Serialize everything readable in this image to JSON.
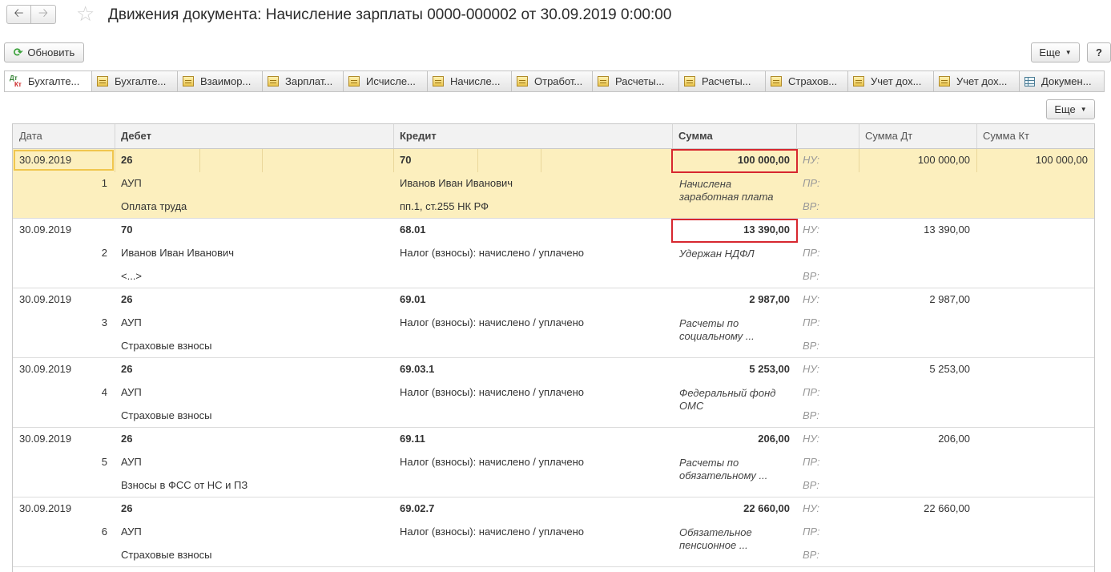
{
  "window": {
    "title": "Движения документа: Начисление зарплаты 0000-000002 от 30.09.2019 0:00:00",
    "back_icon": "arrow-left-icon",
    "forward_icon": "arrow-right-icon",
    "favorite_icon": "star-icon"
  },
  "toolbar": {
    "refresh_label": "Обновить",
    "more_label": "Еще",
    "help_label": "?"
  },
  "tabs": [
    {
      "label": "Бухгалте...",
      "icon": "dt-kt-icon",
      "active": true
    },
    {
      "label": "Бухгалте...",
      "icon": "register-icon"
    },
    {
      "label": "Взаимор...",
      "icon": "register-icon"
    },
    {
      "label": "Зарплат...",
      "icon": "register-icon"
    },
    {
      "label": "Исчисле...",
      "icon": "register-icon"
    },
    {
      "label": "Начисле...",
      "icon": "register-icon"
    },
    {
      "label": "Отработ...",
      "icon": "register-icon"
    },
    {
      "label": "Расчеты...",
      "icon": "register-icon"
    },
    {
      "label": "Расчеты...",
      "icon": "register-icon"
    },
    {
      "label": "Страхов...",
      "icon": "register-icon"
    },
    {
      "label": "Учет дох...",
      "icon": "register-icon"
    },
    {
      "label": "Учет дох...",
      "icon": "register-icon"
    },
    {
      "label": "Докумен...",
      "icon": "table-icon"
    }
  ],
  "panel": {
    "more_label": "Еще"
  },
  "columns": {
    "date": "Дата",
    "debit": "Дебет",
    "credit": "Кредит",
    "amount": "Сумма",
    "blank": "",
    "amount_dt": "Сумма Дт",
    "amount_kt": "Сумма Кт"
  },
  "labels": {
    "nu": "НУ:",
    "pr": "ПР:",
    "vr": "ВР:"
  },
  "rows": [
    {
      "date": "30.09.2019",
      "num": "1",
      "debit": "26",
      "debit_sub1": "АУП",
      "debit_sub2": "Оплата труда",
      "credit": "70",
      "credit_sub1": "Иванов Иван Иванович",
      "credit_sub2": "пп.1, ст.255 НК РФ",
      "amount": "100 000,00",
      "desc1": "Начислена",
      "desc2": "заработная плата",
      "nu_dt": "100 000,00",
      "nu_kt": "100 000,00",
      "selected": true
    },
    {
      "date": "30.09.2019",
      "num": "2",
      "debit": "70",
      "debit_sub1": "Иванов Иван Иванович",
      "debit_sub2": "<...>",
      "credit": "68.01",
      "credit_sub1": "Налог (взносы): начислено / уплачено",
      "credit_sub2": "",
      "amount": "13 390,00",
      "desc1": "Удержан НДФЛ",
      "desc2": "",
      "nu_dt": "13 390,00",
      "nu_kt": ""
    },
    {
      "date": "30.09.2019",
      "num": "3",
      "debit": "26",
      "debit_sub1": "АУП",
      "debit_sub2": "Страховые взносы",
      "credit": "69.01",
      "credit_sub1": "Налог (взносы): начислено / уплачено",
      "credit_sub2": "",
      "amount": "2 987,00",
      "desc1": "Расчеты по",
      "desc2": "социальному ...",
      "nu_dt": "2 987,00",
      "nu_kt": ""
    },
    {
      "date": "30.09.2019",
      "num": "4",
      "debit": "26",
      "debit_sub1": "АУП",
      "debit_sub2": "Страховые взносы",
      "credit": "69.03.1",
      "credit_sub1": "Налог (взносы): начислено / уплачено",
      "credit_sub2": "",
      "amount": "5 253,00",
      "desc1": "Федеральный фонд",
      "desc2": "ОМС",
      "nu_dt": "5 253,00",
      "nu_kt": ""
    },
    {
      "date": "30.09.2019",
      "num": "5",
      "debit": "26",
      "debit_sub1": "АУП",
      "debit_sub2": "Взносы в ФСС от НС и ПЗ",
      "credit": "69.11",
      "credit_sub1": "Налог (взносы): начислено / уплачено",
      "credit_sub2": "",
      "amount": "206,00",
      "desc1": "Расчеты по",
      "desc2": "обязательному ...",
      "nu_dt": "206,00",
      "nu_kt": ""
    },
    {
      "date": "30.09.2019",
      "num": "6",
      "debit": "26",
      "debit_sub1": "АУП",
      "debit_sub2": "Страховые взносы",
      "credit": "69.02.7",
      "credit_sub1": "Налог (взносы): начислено / уплачено",
      "credit_sub2": "",
      "amount": "22 660,00",
      "desc1": "Обязательное",
      "desc2": "пенсионное ...",
      "nu_dt": "22 660,00",
      "nu_kt": ""
    }
  ],
  "colors": {
    "selected_row": "#fcefbe",
    "highlight_border": "#d7272f",
    "refresh_icon": "#3aa13a"
  }
}
